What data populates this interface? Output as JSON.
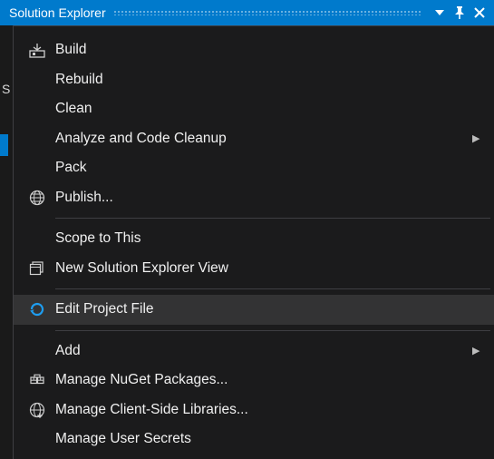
{
  "titlebar": {
    "title": "Solution Explorer"
  },
  "left": {
    "char": "S"
  },
  "menu": {
    "build": "Build",
    "rebuild": "Rebuild",
    "clean": "Clean",
    "analyze": "Analyze and Code Cleanup",
    "pack": "Pack",
    "publish": "Publish...",
    "scope": "Scope to This",
    "newView": "New Solution Explorer View",
    "editProject": "Edit Project File",
    "add": "Add",
    "manageNuget": "Manage NuGet Packages...",
    "manageClientLibs": "Manage Client-Side Libraries...",
    "manageSecrets": "Manage User Secrets"
  }
}
